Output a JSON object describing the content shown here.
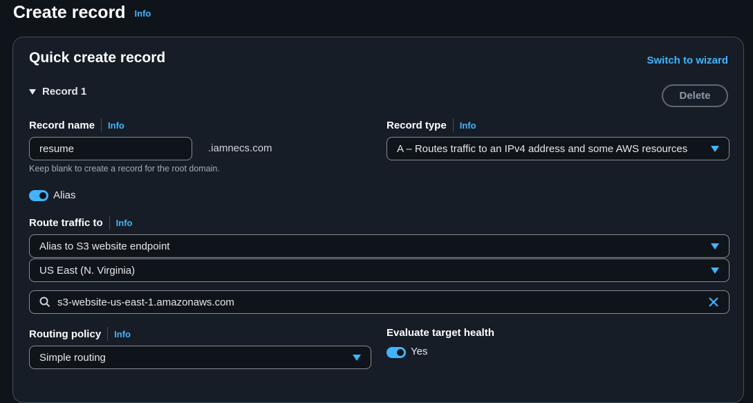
{
  "page": {
    "title": "Create record",
    "info": "Info"
  },
  "panel": {
    "title": "Quick create record",
    "switch_label": "Switch to wizard",
    "record": {
      "heading": "Record 1",
      "delete_label": "Delete",
      "record_name": {
        "label": "Record name",
        "info": "Info",
        "value": "resume",
        "suffix": ".iamnecs.com",
        "hint": "Keep blank to create a record for the root domain."
      },
      "record_type": {
        "label": "Record type",
        "info": "Info",
        "value": "A – Routes traffic to an IPv4 address and some AWS resources"
      },
      "alias": {
        "label": "Alias",
        "enabled": true
      },
      "route_traffic": {
        "label": "Route traffic to",
        "info": "Info",
        "endpoint": "Alias to S3 website endpoint",
        "region": "US East (N. Virginia)",
        "search_value": "s3-website-us-east-1.amazonaws.com"
      },
      "routing_policy": {
        "label": "Routing policy",
        "info": "Info",
        "value": "Simple routing"
      },
      "evaluate_health": {
        "label": "Evaluate target health",
        "toggle_label": "Yes",
        "enabled": true
      }
    }
  },
  "colors": {
    "accent": "#42b4ff",
    "background": "#0f141a",
    "panel": "#161d26"
  },
  "icons": {
    "search": "search-icon",
    "clear": "close-icon",
    "dropdown": "caret-down-icon"
  }
}
